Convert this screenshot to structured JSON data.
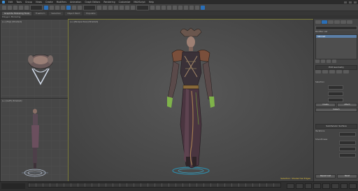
{
  "menu": {
    "items": [
      "Edit",
      "Tools",
      "Group",
      "Views",
      "Create",
      "Modifiers",
      "Animation",
      "Graph Editors",
      "Rendering",
      "Customize",
      "MAXScript",
      "Help"
    ]
  },
  "ribbon": {
    "tabs": [
      "Graphite Modeling Tools",
      "Freeform",
      "Selection",
      "Object Paint",
      "Populate"
    ],
    "sub_label": "Polygon Modeling"
  },
  "viewports": {
    "top_label": "[+] [Top] [Shaded]",
    "left_label": "[+] [Left] [Shaded]",
    "persp_label": "[+] [Perspective] [Shaded]",
    "persp_note": "Selection: Shaded Sel Edges"
  },
  "command_panel": {
    "modifier_list": "Modifier List",
    "stack_item": "Skinned",
    "rollout_edit": "Edit Geometry",
    "rollout_selection": "Selection",
    "rollout_subdiv": "Subdivision Surface",
    "btn_create": "Create",
    "btn_attach": "Attach",
    "btn_detach": "Detach",
    "label_iterations": "Iterations",
    "label_smoothness": "Smoothness",
    "btn_repeat_last": "Repeat Last",
    "btn_reset": "Reset"
  },
  "colors": {
    "accent": "#3d8fd6",
    "viewport_border_active": "#7a7a3a",
    "note_yellow": "#e0c040"
  }
}
